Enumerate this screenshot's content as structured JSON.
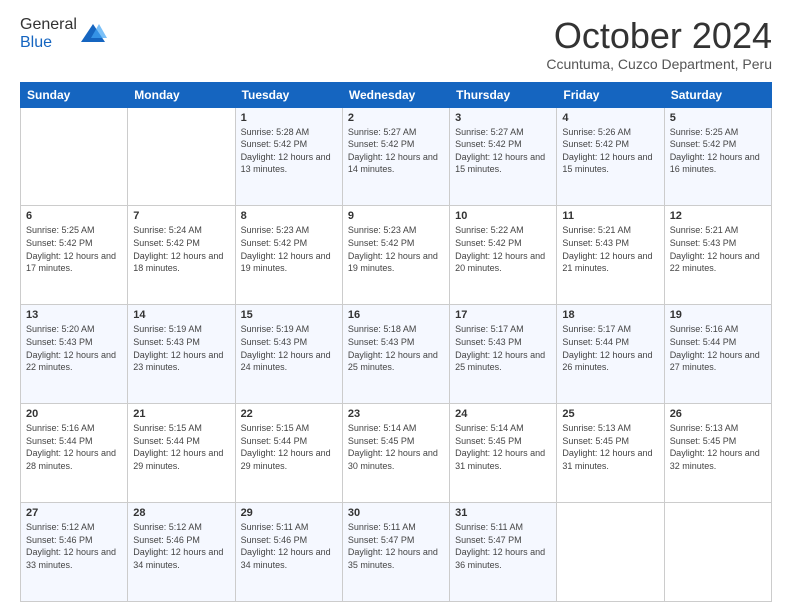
{
  "logo": {
    "general": "General",
    "blue": "Blue"
  },
  "header": {
    "month": "October 2024",
    "location": "Ccuntuma, Cuzco Department, Peru"
  },
  "weekdays": [
    "Sunday",
    "Monday",
    "Tuesday",
    "Wednesday",
    "Thursday",
    "Friday",
    "Saturday"
  ],
  "weeks": [
    [
      {
        "day": "",
        "sunrise": "",
        "sunset": "",
        "daylight": ""
      },
      {
        "day": "",
        "sunrise": "",
        "sunset": "",
        "daylight": ""
      },
      {
        "day": "1",
        "sunrise": "Sunrise: 5:28 AM",
        "sunset": "Sunset: 5:42 PM",
        "daylight": "Daylight: 12 hours and 13 minutes."
      },
      {
        "day": "2",
        "sunrise": "Sunrise: 5:27 AM",
        "sunset": "Sunset: 5:42 PM",
        "daylight": "Daylight: 12 hours and 14 minutes."
      },
      {
        "day": "3",
        "sunrise": "Sunrise: 5:27 AM",
        "sunset": "Sunset: 5:42 PM",
        "daylight": "Daylight: 12 hours and 15 minutes."
      },
      {
        "day": "4",
        "sunrise": "Sunrise: 5:26 AM",
        "sunset": "Sunset: 5:42 PM",
        "daylight": "Daylight: 12 hours and 15 minutes."
      },
      {
        "day": "5",
        "sunrise": "Sunrise: 5:25 AM",
        "sunset": "Sunset: 5:42 PM",
        "daylight": "Daylight: 12 hours and 16 minutes."
      }
    ],
    [
      {
        "day": "6",
        "sunrise": "Sunrise: 5:25 AM",
        "sunset": "Sunset: 5:42 PM",
        "daylight": "Daylight: 12 hours and 17 minutes."
      },
      {
        "day": "7",
        "sunrise": "Sunrise: 5:24 AM",
        "sunset": "Sunset: 5:42 PM",
        "daylight": "Daylight: 12 hours and 18 minutes."
      },
      {
        "day": "8",
        "sunrise": "Sunrise: 5:23 AM",
        "sunset": "Sunset: 5:42 PM",
        "daylight": "Daylight: 12 hours and 19 minutes."
      },
      {
        "day": "9",
        "sunrise": "Sunrise: 5:23 AM",
        "sunset": "Sunset: 5:42 PM",
        "daylight": "Daylight: 12 hours and 19 minutes."
      },
      {
        "day": "10",
        "sunrise": "Sunrise: 5:22 AM",
        "sunset": "Sunset: 5:42 PM",
        "daylight": "Daylight: 12 hours and 20 minutes."
      },
      {
        "day": "11",
        "sunrise": "Sunrise: 5:21 AM",
        "sunset": "Sunset: 5:43 PM",
        "daylight": "Daylight: 12 hours and 21 minutes."
      },
      {
        "day": "12",
        "sunrise": "Sunrise: 5:21 AM",
        "sunset": "Sunset: 5:43 PM",
        "daylight": "Daylight: 12 hours and 22 minutes."
      }
    ],
    [
      {
        "day": "13",
        "sunrise": "Sunrise: 5:20 AM",
        "sunset": "Sunset: 5:43 PM",
        "daylight": "Daylight: 12 hours and 22 minutes."
      },
      {
        "day": "14",
        "sunrise": "Sunrise: 5:19 AM",
        "sunset": "Sunset: 5:43 PM",
        "daylight": "Daylight: 12 hours and 23 minutes."
      },
      {
        "day": "15",
        "sunrise": "Sunrise: 5:19 AM",
        "sunset": "Sunset: 5:43 PM",
        "daylight": "Daylight: 12 hours and 24 minutes."
      },
      {
        "day": "16",
        "sunrise": "Sunrise: 5:18 AM",
        "sunset": "Sunset: 5:43 PM",
        "daylight": "Daylight: 12 hours and 25 minutes."
      },
      {
        "day": "17",
        "sunrise": "Sunrise: 5:17 AM",
        "sunset": "Sunset: 5:43 PM",
        "daylight": "Daylight: 12 hours and 25 minutes."
      },
      {
        "day": "18",
        "sunrise": "Sunrise: 5:17 AM",
        "sunset": "Sunset: 5:44 PM",
        "daylight": "Daylight: 12 hours and 26 minutes."
      },
      {
        "day": "19",
        "sunrise": "Sunrise: 5:16 AM",
        "sunset": "Sunset: 5:44 PM",
        "daylight": "Daylight: 12 hours and 27 minutes."
      }
    ],
    [
      {
        "day": "20",
        "sunrise": "Sunrise: 5:16 AM",
        "sunset": "Sunset: 5:44 PM",
        "daylight": "Daylight: 12 hours and 28 minutes."
      },
      {
        "day": "21",
        "sunrise": "Sunrise: 5:15 AM",
        "sunset": "Sunset: 5:44 PM",
        "daylight": "Daylight: 12 hours and 29 minutes."
      },
      {
        "day": "22",
        "sunrise": "Sunrise: 5:15 AM",
        "sunset": "Sunset: 5:44 PM",
        "daylight": "Daylight: 12 hours and 29 minutes."
      },
      {
        "day": "23",
        "sunrise": "Sunrise: 5:14 AM",
        "sunset": "Sunset: 5:45 PM",
        "daylight": "Daylight: 12 hours and 30 minutes."
      },
      {
        "day": "24",
        "sunrise": "Sunrise: 5:14 AM",
        "sunset": "Sunset: 5:45 PM",
        "daylight": "Daylight: 12 hours and 31 minutes."
      },
      {
        "day": "25",
        "sunrise": "Sunrise: 5:13 AM",
        "sunset": "Sunset: 5:45 PM",
        "daylight": "Daylight: 12 hours and 31 minutes."
      },
      {
        "day": "26",
        "sunrise": "Sunrise: 5:13 AM",
        "sunset": "Sunset: 5:45 PM",
        "daylight": "Daylight: 12 hours and 32 minutes."
      }
    ],
    [
      {
        "day": "27",
        "sunrise": "Sunrise: 5:12 AM",
        "sunset": "Sunset: 5:46 PM",
        "daylight": "Daylight: 12 hours and 33 minutes."
      },
      {
        "day": "28",
        "sunrise": "Sunrise: 5:12 AM",
        "sunset": "Sunset: 5:46 PM",
        "daylight": "Daylight: 12 hours and 34 minutes."
      },
      {
        "day": "29",
        "sunrise": "Sunrise: 5:11 AM",
        "sunset": "Sunset: 5:46 PM",
        "daylight": "Daylight: 12 hours and 34 minutes."
      },
      {
        "day": "30",
        "sunrise": "Sunrise: 5:11 AM",
        "sunset": "Sunset: 5:47 PM",
        "daylight": "Daylight: 12 hours and 35 minutes."
      },
      {
        "day": "31",
        "sunrise": "Sunrise: 5:11 AM",
        "sunset": "Sunset: 5:47 PM",
        "daylight": "Daylight: 12 hours and 36 minutes."
      },
      {
        "day": "",
        "sunrise": "",
        "sunset": "",
        "daylight": ""
      },
      {
        "day": "",
        "sunrise": "",
        "sunset": "",
        "daylight": ""
      }
    ]
  ]
}
